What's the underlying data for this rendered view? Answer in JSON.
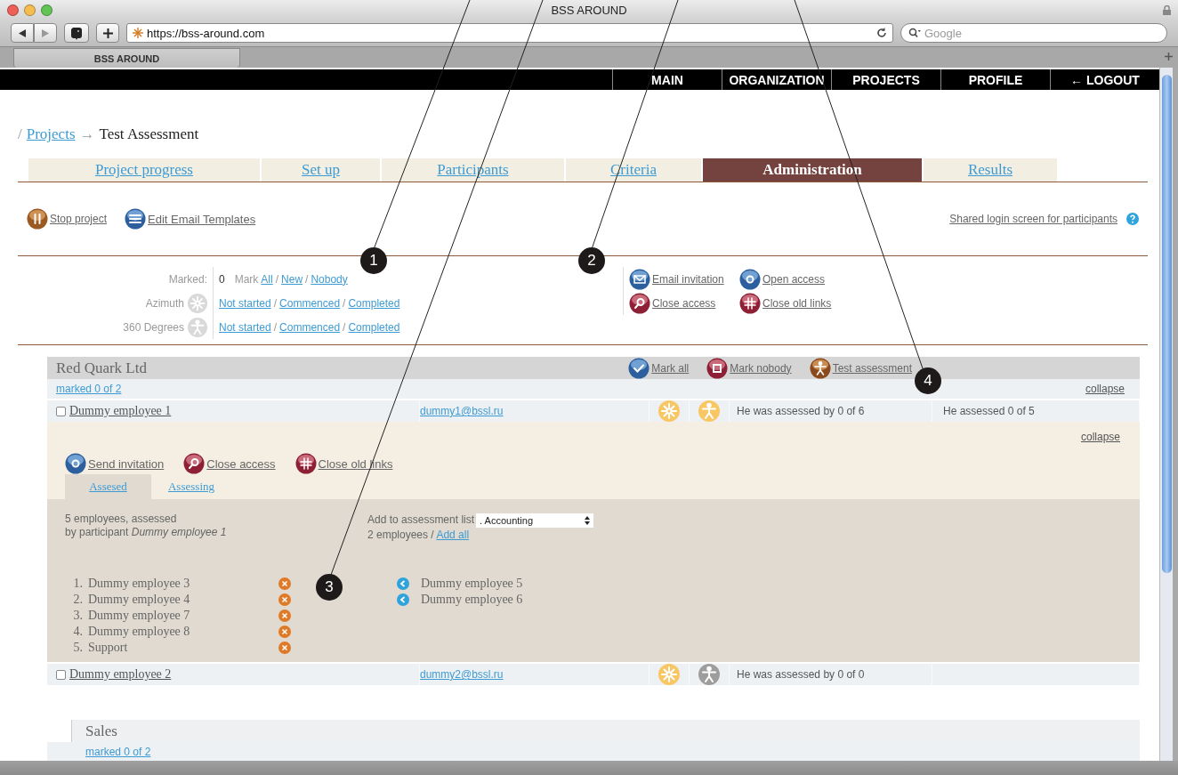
{
  "browser": {
    "title": "BSS AROUND",
    "url": "https://bss-around.com",
    "search_placeholder": "Google",
    "tab": "BSS AROUND"
  },
  "nav": [
    "MAIN",
    "ORGANIZATION",
    "PROJECTS",
    "PROFILE",
    "← LOGOUT"
  ],
  "breadcrumb": {
    "separator": "/",
    "link": "Projects",
    "arrow": "→",
    "current": "Test Assessment"
  },
  "tabs": [
    {
      "label": "Project progress",
      "selected": false
    },
    {
      "label": "Set up",
      "selected": false
    },
    {
      "label": "Participants",
      "selected": false
    },
    {
      "label": "Criteria",
      "selected": false
    },
    {
      "label": "Administration",
      "selected": true
    },
    {
      "label": "Results",
      "selected": false
    }
  ],
  "actions": [
    {
      "label": "Stop project",
      "kind": "pause"
    },
    {
      "label": "Edit Email Templates",
      "kind": "list"
    }
  ],
  "shared_login": "Shared login screen for participants",
  "filter": {
    "marked_label": "Marked:",
    "marked_count": "0",
    "mark_label": "Mark",
    "mark_links": [
      "All",
      "New",
      "Nobody"
    ],
    "separator": "/",
    "rows": [
      {
        "label": "Azimuth",
        "kind": "azimuth",
        "links": [
          "Not started",
          "Commenced",
          "Completed"
        ]
      },
      {
        "label": "360 Degrees",
        "kind": "person",
        "links": [
          "Not started",
          "Commenced",
          "Completed"
        ]
      }
    ]
  },
  "bulk_actions": [
    {
      "label": "Email invitation",
      "kind": "mail"
    },
    {
      "label": "Open access",
      "kind": "open"
    },
    {
      "label": "Close access",
      "kind": "close"
    },
    {
      "label": "Close old links",
      "kind": "links"
    }
  ],
  "groups": [
    {
      "kind": "company",
      "name": "Red Quark Ltd",
      "actions": [
        {
          "label": "Mark all",
          "kind": "check"
        },
        {
          "label": "Mark nobody",
          "kind": "square"
        },
        {
          "label": "Test assessment",
          "kind": "person"
        }
      ],
      "marked": "marked 0 of 2",
      "collapse": "collapse",
      "employees": [
        {
          "name": "Dummy employee 1",
          "email": "dummy1@bssl.ru",
          "checked": false,
          "azimuth_active": true,
          "degrees_active": true,
          "assessed_by": "He was assessed by 0 of 6",
          "assessed": "He assessed 0 of 5",
          "expanded": true,
          "detail": {
            "actions": [
              {
                "label": "Send invitation",
                "kind": "open"
              },
              {
                "label": "Close access",
                "kind": "close"
              },
              {
                "label": "Close old links",
                "kind": "links"
              }
            ],
            "collapse": "collapse",
            "tabs": [
              {
                "label": "Assesed",
                "selected": true
              },
              {
                "label": "Assessing",
                "selected": false
              }
            ],
            "summary": [
              "5 employees, assessed",
              "by participant *Dummy employee 1*"
            ],
            "add_label": "Add to assessment list",
            "select_value": ". Accounting",
            "count_text": "2 employees /",
            "add_all": "Add all",
            "assessed_list": [
              {
                "number": "1.",
                "name": "Dummy employee 3"
              },
              {
                "number": "2.",
                "name": "Dummy employee 4"
              },
              {
                "number": "3.",
                "name": "Dummy employee 7"
              },
              {
                "number": "4.",
                "name": "Dummy employee 8"
              },
              {
                "number": "5.",
                "name": "Support"
              }
            ],
            "candidates": [
              "Dummy employee 5",
              "Dummy employee 6"
            ]
          }
        },
        {
          "name": "Dummy employee 2",
          "email": "dummy2@bssl.ru",
          "checked": false,
          "azimuth_active": true,
          "degrees_active": false,
          "assessed_by": "He was assessed by 0 of 0",
          "expanded": false
        }
      ]
    },
    {
      "kind": "department",
      "name": "Sales",
      "marked": "marked 0 of 2"
    }
  ],
  "callouts": [
    "1",
    "2",
    "3",
    "4"
  ]
}
